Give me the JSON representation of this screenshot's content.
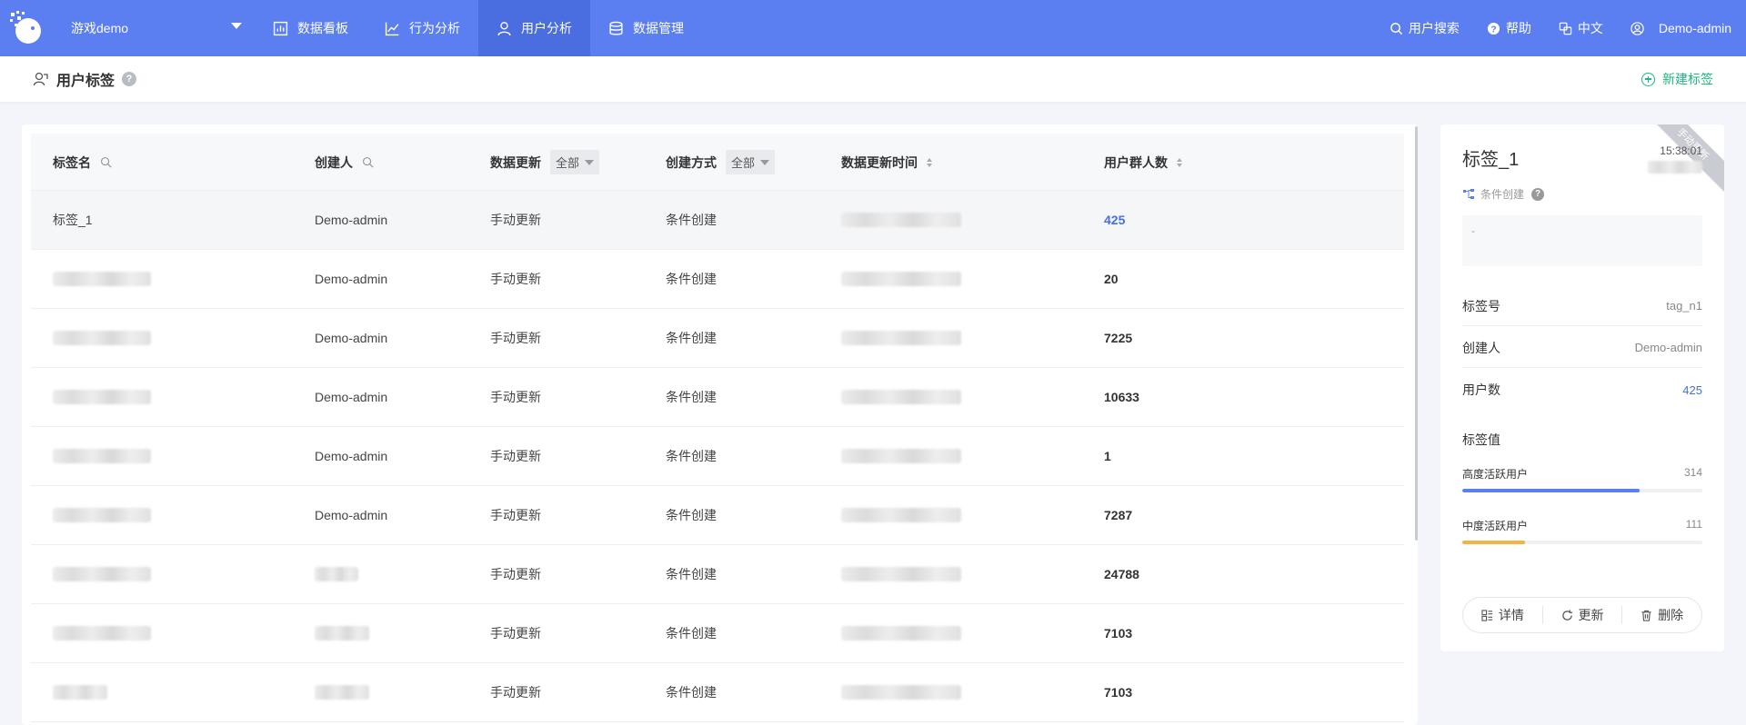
{
  "nav": {
    "app_name": "游戏demo",
    "items": [
      {
        "label": "数据看板",
        "icon": "bar-chart-icon"
      },
      {
        "label": "行为分析",
        "icon": "trend-icon"
      },
      {
        "label": "用户分析",
        "icon": "user-icon",
        "active": true
      },
      {
        "label": "数据管理",
        "icon": "database-icon"
      }
    ],
    "right": {
      "search": "用户搜索",
      "help": "帮助",
      "lang": "中文",
      "user": "Demo-admin"
    },
    "colors": {
      "bar": "#5b7ff0",
      "active": "#4a6de0"
    }
  },
  "header": {
    "title": "用户标签",
    "help_mark": "?",
    "new_tag": "新建标签"
  },
  "table": {
    "columns": {
      "name": "标签名",
      "creator": "创建人",
      "update": "数据更新",
      "update_filter": "全部",
      "method": "创建方式",
      "method_filter": "全部",
      "time": "数据更新时间",
      "count": "用户群人数"
    },
    "rows": [
      {
        "name": "标签_1",
        "creator": "Demo-admin",
        "update": "手动更新",
        "method": "条件创建",
        "count": "425"
      },
      {
        "name": "",
        "creator": "Demo-admin",
        "update": "手动更新",
        "method": "条件创建",
        "count": "20"
      },
      {
        "name": "",
        "creator": "Demo-admin",
        "update": "手动更新",
        "method": "条件创建",
        "count": "7225"
      },
      {
        "name": "",
        "creator": "Demo-admin",
        "update": "手动更新",
        "method": "条件创建",
        "count": "10633"
      },
      {
        "name": "",
        "creator": "Demo-admin",
        "update": "手动更新",
        "method": "条件创建",
        "count": "1"
      },
      {
        "name": "",
        "creator": "Demo-admin",
        "update": "手动更新",
        "method": "条件创建",
        "count": "7287"
      },
      {
        "name": "",
        "creator": "",
        "update": "手动更新",
        "method": "条件创建",
        "count": "24788"
      },
      {
        "name": "",
        "creator": "",
        "update": "手动更新",
        "method": "条件创建",
        "count": "7103"
      },
      {
        "name": "",
        "creator": "",
        "update": "手动更新",
        "method": "条件创建",
        "count": "7103"
      }
    ]
  },
  "detail": {
    "title": "标签_1",
    "time": "15:38:01",
    "ribbon": "手动更新",
    "method": "条件创建",
    "help_mark": "?",
    "desc": "-",
    "tag_id_label": "标签号",
    "tag_id": "tag_n1",
    "creator_label": "创建人",
    "creator": "Demo-admin",
    "users_label": "用户数",
    "users": "425",
    "values_label": "标签值",
    "values": [
      {
        "label": "高度活跃用户",
        "count": "314",
        "fraction": 0.739,
        "color": "#5b7ff0"
      },
      {
        "label": "中度活跃用户",
        "count": "111",
        "fraction": 0.261,
        "color": "#f5b342"
      }
    ],
    "actions": {
      "details": "详情",
      "update": "更新",
      "delete": "删除"
    }
  }
}
